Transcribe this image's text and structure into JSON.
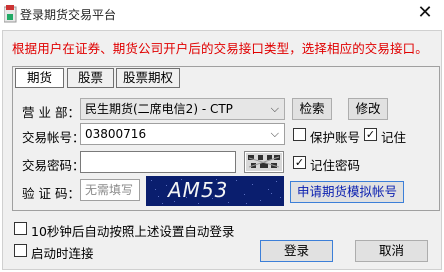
{
  "window": {
    "title": "登录期货交易平台",
    "close": "✕"
  },
  "notice": "根据用户在证券、期货公司开户后的交易接口类型，选择相应的交易接口。",
  "tabs": [
    {
      "label": "期货",
      "active": true
    },
    {
      "label": "股票",
      "active": false
    },
    {
      "label": "股票期权",
      "active": false
    }
  ],
  "form": {
    "branch_label": "营 业 部：",
    "branch_value": "民生期货(二席电信2) - CTP",
    "search_label": "检索",
    "modify_label": "修改",
    "account_label": "交易帐号：",
    "account_value": "03800716",
    "save_account_label": "保护账号",
    "remember_label": "记住",
    "remember_checked": true,
    "password_label": "交易密码：",
    "password_value": "",
    "remember_password_label": "记住密码",
    "remember_password_checked": true,
    "captcha_label": "验 证 码：",
    "captcha_placeholder": "无需填写",
    "captcha_text": "AM53",
    "apply_demo_label": "申请期货模拟帐号"
  },
  "options": {
    "auto_login_label": "10秒钟后自动按照上述设置自动登录",
    "connect_on_start_label": "启动时连接"
  },
  "actions": {
    "login_label": "登录",
    "cancel_label": "取消"
  },
  "colors": {
    "notice": "#e00000",
    "link": "#0a1fb0",
    "captcha_bg": "#0a1e6e"
  }
}
